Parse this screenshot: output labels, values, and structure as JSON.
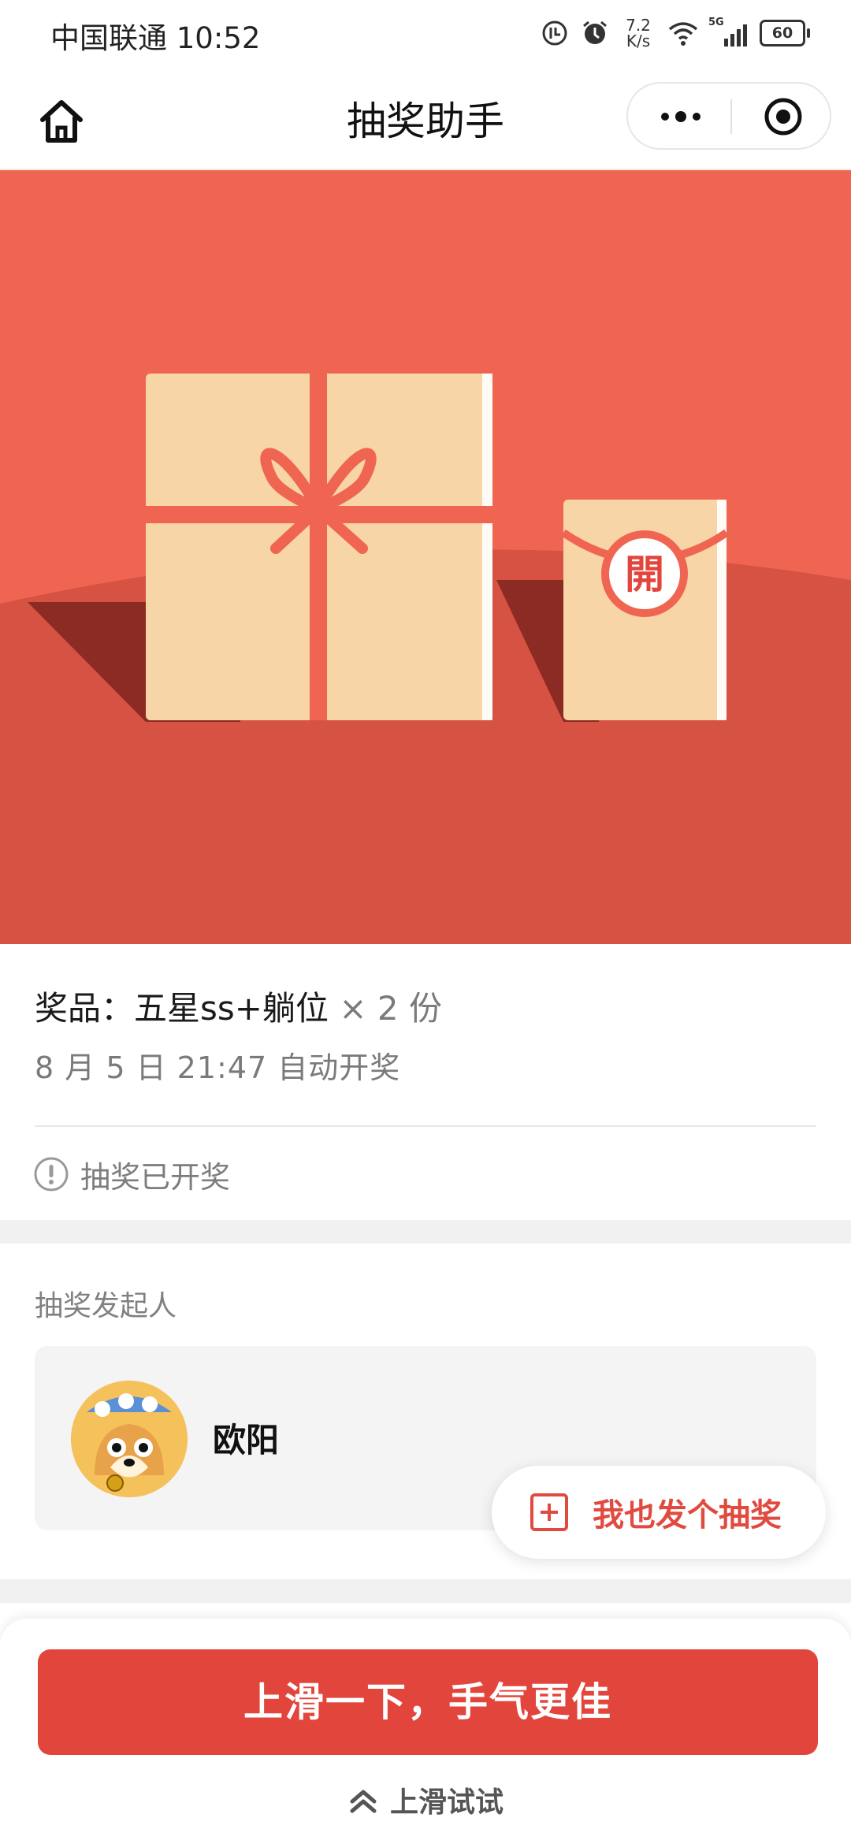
{
  "status_bar": {
    "carrier": "中国联通",
    "time": "10:52",
    "net_speed_value": "7.2",
    "net_speed_unit": "K/s",
    "signal_type": "5G",
    "battery": "60"
  },
  "nav": {
    "title": "抽奖助手",
    "home_icon": "home-icon",
    "more_icon": "more-dots-icon",
    "close_icon": "target-icon"
  },
  "hero": {
    "seal_char": "開",
    "colors": {
      "top": "#f06552",
      "bottom": "#d65243",
      "gift": "#f7d5a6",
      "ribbon": "#f06552"
    }
  },
  "prize": {
    "label": "奖品：",
    "name": "五星ss+躺位",
    "quantity": "× 2 份",
    "draw_time": "8 月 5 日 21:47 自动开奖",
    "status": "抽奖已开奖"
  },
  "initiator": {
    "section_label": "抽奖发起人",
    "name": "欧阳"
  },
  "float_action": {
    "label": "我也发个抽奖"
  },
  "bottom": {
    "button_label": "上滑一下，手气更佳",
    "hint": "上滑试试"
  },
  "colors": {
    "accent": "#e2453b",
    "muted_text": "#7a7a7a"
  }
}
